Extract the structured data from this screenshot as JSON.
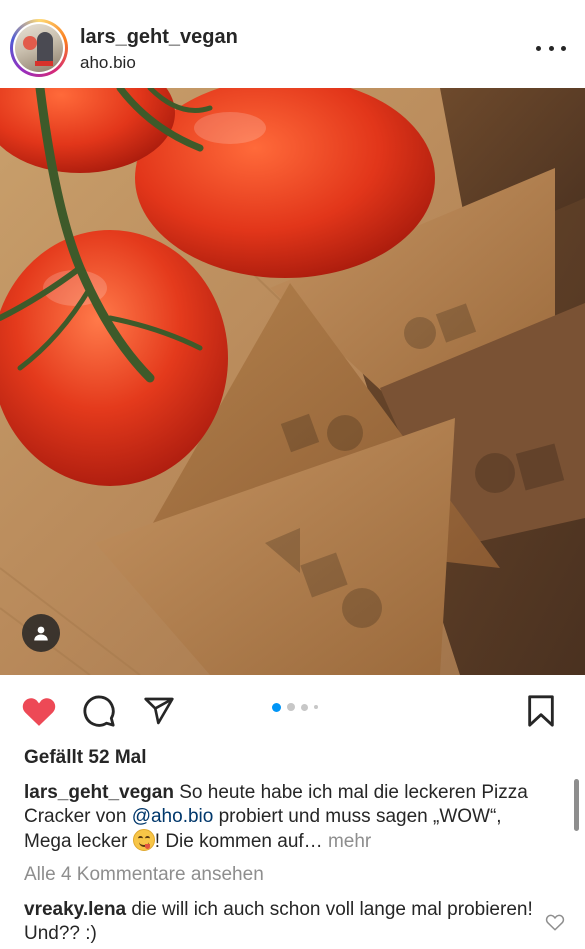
{
  "post": {
    "username": "lars_geht_vegan",
    "location": "aho.bio",
    "more_icon": "more-horizontal-icon"
  },
  "media": {
    "description_icon": "user-tag-icon",
    "carousel_count": 4,
    "carousel_active_index": 0
  },
  "actions": {
    "like_icon": "heart-filled-icon",
    "comment_icon": "comment-icon",
    "share_icon": "send-icon",
    "save_icon": "bookmark-icon",
    "like_color": "#ed4956"
  },
  "likes": {
    "text": "Gefällt 52 Mal"
  },
  "caption": {
    "username": "lars_geht_vegan",
    "text_before": " So heute habe ich mal die leckeren Pizza Cracker von ",
    "mention": "@aho.bio",
    "text_middle": " probiert und muss sagen „WOW“, Mega lecker ",
    "emoji": "smiling-face-icon",
    "text_after": "! Die kommen auf…",
    "more_label": " mehr"
  },
  "comments": {
    "view_all": "Alle 4 Kommentare ansehen",
    "items": [
      {
        "username": "vreaky.lena",
        "text": " die will ich auch schon voll lange mal probieren! Und?? :)"
      }
    ]
  },
  "colors": {
    "link": "#00376b",
    "muted": "#8e8e8e",
    "dot_active": "#0095f6",
    "dot_inactive": "#c7c7c7"
  }
}
